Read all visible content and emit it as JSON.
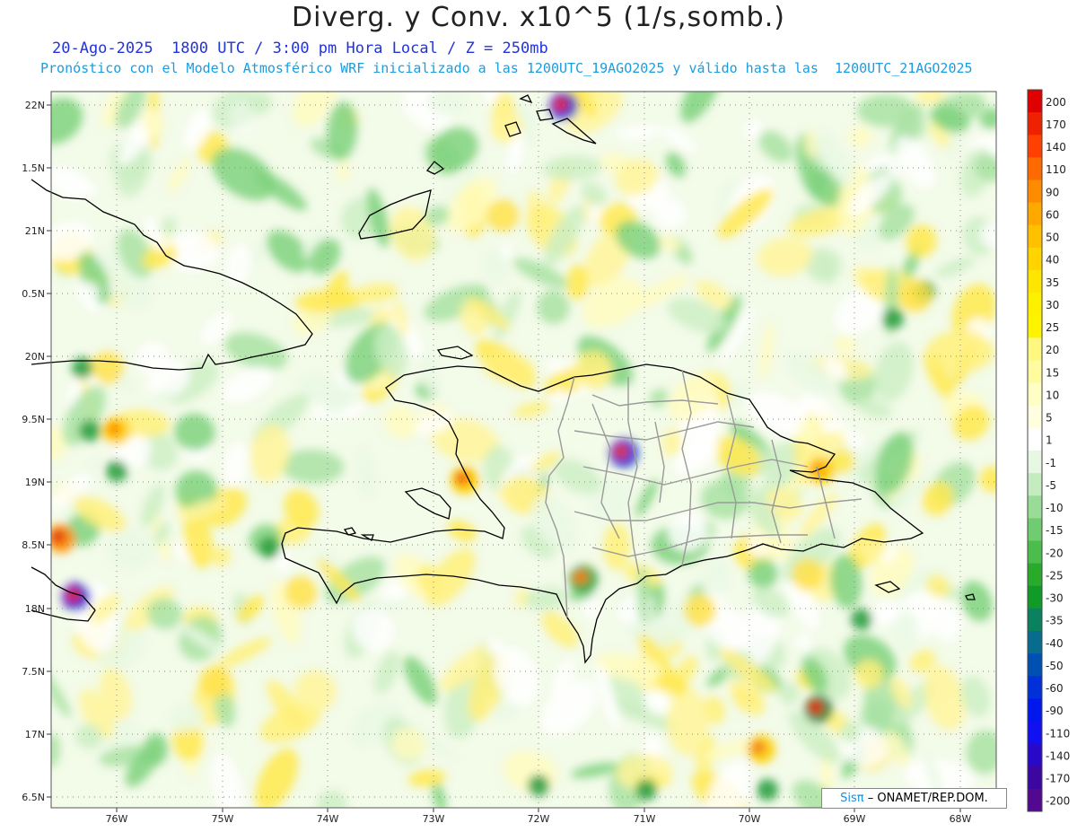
{
  "title": "Diverg. y Conv. x10^5 (1/s,somb.)",
  "subtitle_date": "20-Ago-2025  1800 UTC / 3:00 pm Hora Local / Z = 250mb",
  "subtitle_model": "Pronóstico con el Modelo Atmosférico WRF inicializado a las 1200UTC_19AGO2025 y válido hasta las  1200UTC_21AGO2025",
  "lat_labels": [
    "22N",
    "1.5N",
    "21N",
    "0.5N",
    "20N",
    "9.5N",
    "19N",
    "8.5N",
    "18N",
    "7.5N",
    "17N",
    "6.5N"
  ],
  "lon_labels": [
    "76W",
    "75W",
    "74W",
    "73W",
    "72W",
    "71W",
    "70W",
    "69W",
    "68W"
  ],
  "colorbar": {
    "labels": [
      "200",
      "170",
      "140",
      "110",
      "90",
      "60",
      "50",
      "40",
      "35",
      "30",
      "25",
      "20",
      "15",
      "10",
      "5",
      "1",
      "-1",
      "-5",
      "-10",
      "-15",
      "-20",
      "-25",
      "-30",
      "-35",
      "-40",
      "-50",
      "-60",
      "-90",
      "-110",
      "-140",
      "-170",
      "-200"
    ],
    "colors": [
      "#e00000",
      "#ee2200",
      "#ff4000",
      "#ff6a00",
      "#ff8c00",
      "#ffa800",
      "#ffc000",
      "#ffd400",
      "#ffe600",
      "#fff000",
      "#fff400",
      "#fff880",
      "#fffca0",
      "#fffec4",
      "#ffffe0",
      "#ffffff",
      "#e8f7e4",
      "#c4ecc0",
      "#98dc98",
      "#70cc70",
      "#4cbc4c",
      "#2aaa2a",
      "#109a28",
      "#0a8260",
      "#086c8e",
      "#0050b4",
      "#0030d8",
      "#0018ee",
      "#1010f0",
      "#2a08c8",
      "#3c06a0",
      "#520890"
    ]
  },
  "credit": {
    "brand": "Sisπ",
    "text": "– ONAMET/REP.DOM."
  }
}
